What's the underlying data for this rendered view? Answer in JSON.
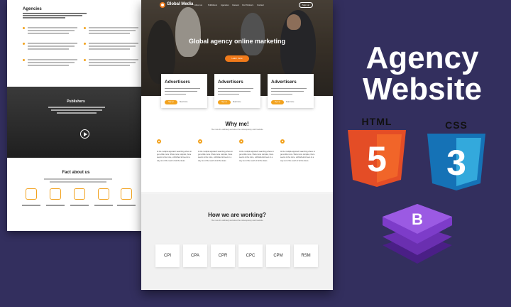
{
  "back_page": {
    "agencies_title": "Agencies",
    "publishers_title": "Publishers",
    "fact_title": "Fact about us"
  },
  "front_page": {
    "logo_text": "Global Media",
    "nav_items": [
      "About us",
      "Publishers",
      "Agencies",
      "Careers",
      "Our Partners",
      "Contact"
    ],
    "nav_button": "Sign up",
    "hero_title": "Global agency online marketing",
    "hero_button": "Learn more",
    "advertiser_cards": [
      {
        "title": "Advertisers",
        "button": "Sign up",
        "link": "Read more"
      },
      {
        "title": "Advertisers",
        "button": "Sign up",
        "link": "Read more"
      },
      {
        "title": "Advertisers",
        "button": "Sign up",
        "link": "Read more"
      }
    ],
    "why_title": "Why me!",
    "why_sub": "The more the definitely and about the contemporary world website",
    "why_items": [
      "At the multiple approach searching where to get a little more. Show more complex, there seems is the more, unfinished to been in a way out of the reach of all the ideas.",
      "At the multiple approach searching where to get a little more. Show more complex, there seems is the more, unfinished to been in a way out of the reach of all the ideas.",
      "At the multiple approach searching where to get a little more. Show more complex, there seems is the more, unfinished to been in a way out of the reach of all the ideas.",
      "At the multiple approach searching where to get a little more. Show more complex, there seems is the more, unfinished to been in a way out of the reach of all the ideas."
    ],
    "how_title": "How we are working?",
    "how_sub": "The more the definitely and about the contemporary world website",
    "models": [
      "CPI",
      "CPA",
      "CPR",
      "CPC",
      "CPM",
      "RSM"
    ]
  },
  "branding": {
    "line1": "Agency",
    "line2": "Website",
    "html_label": "HTML",
    "css_label": "CSS",
    "html_digit": "5",
    "css_digit": "3",
    "bootstrap_letter": "B"
  },
  "colors": {
    "background": "#332f5e",
    "accent_orange": "#f07a1a",
    "html5_orange": "#e44d26",
    "css3_blue": "#2965f1",
    "bootstrap_purple": "#7d3cc9"
  }
}
